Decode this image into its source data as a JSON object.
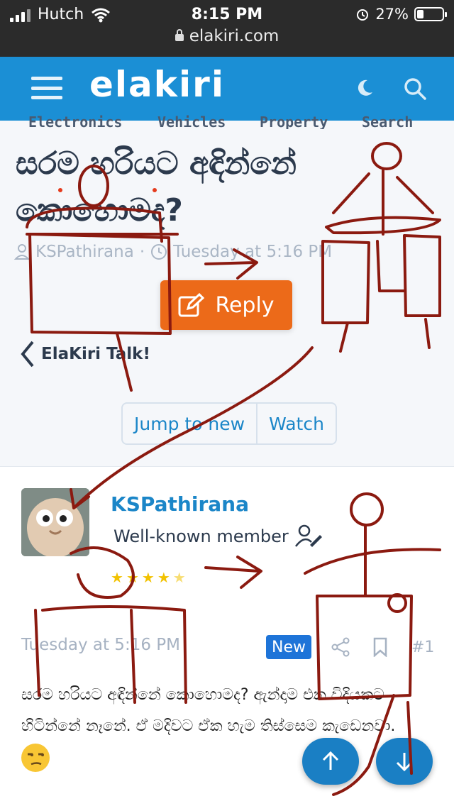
{
  "status_bar": {
    "carrier": "Hutch",
    "time": "8:15 PM",
    "battery": "27%"
  },
  "url_bar": {
    "domain": "elakiri.com"
  },
  "header": {
    "logo": "elakiri",
    "icons": [
      "menu-icon",
      "moon-icon",
      "search-icon"
    ]
  },
  "nav": {
    "items": [
      "Electronics",
      "Vehicles",
      "Property",
      "Search"
    ]
  },
  "thread": {
    "title": "සරම හරියට අඳින්නේ කොහොමද?",
    "author": "KSPathirana",
    "date": "Tuesday at 5:16 PM",
    "reply_label": "Reply",
    "back_label": "ElaKiri Talk!",
    "jump_label": "Jump to new",
    "watch_label": "Watch"
  },
  "post": {
    "username": "KSPathirana",
    "user_title": "Well-known member",
    "rating": {
      "value": 4.5,
      "max": 5
    },
    "date": "Tuesday at 5:16 PM",
    "badge": "New",
    "number": "#1",
    "body": "සරම හරියට අඳින්නේ කොහොමද? ඇන්දාම එක විදියකට හිටින්නේ නෑනේ. ඒ මදිවට ඒක හැම තිස්සෙම කැඩෙනවා."
  },
  "colors": {
    "brand": "#1b8fd5",
    "reply": "#ec6a19",
    "link": "#1b86c8",
    "scribble": "#8b1a10"
  }
}
